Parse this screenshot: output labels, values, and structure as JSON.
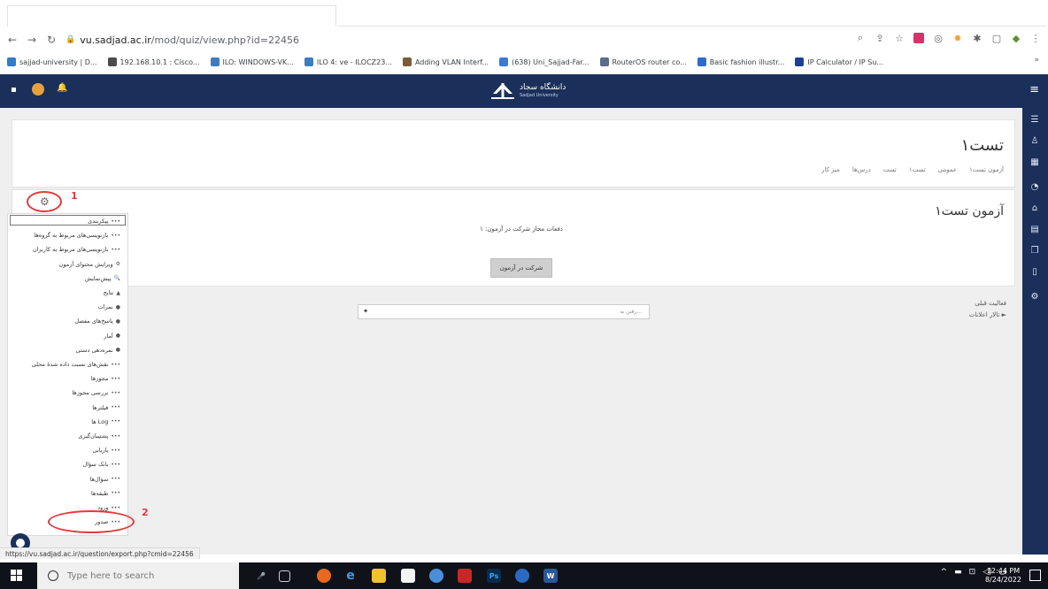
{
  "browser": {
    "url_host": "vu.sadjad.ac.ir",
    "url_path": "/mod/quiz/view.php?id=22456",
    "bookmarks": [
      {
        "label": "sajjad-university | D...",
        "color": "#2f7dc7"
      },
      {
        "label": "192.168.10.1 : Cisco...",
        "color": "#4b4b4b"
      },
      {
        "label": "ILO: WINDOWS-VK...",
        "color": "#3c7dbf"
      },
      {
        "label": "ILO 4: ve - ILOCZ23...",
        "color": "#3c7dbf"
      },
      {
        "label": "Adding VLAN Interf...",
        "color": "#7a5c3a"
      },
      {
        "label": "(638) Uni_Sajjad-Far...",
        "color": "#3a7bd5"
      },
      {
        "label": "RouterOS router co...",
        "color": "#5b6b8a"
      },
      {
        "label": "Basic fashion illustr...",
        "color": "#2a6ec9"
      },
      {
        "label": "IP Calculator / IP Su...",
        "color": "#1c3f95"
      }
    ],
    "bookmarks_more": "»",
    "status_url": "https://vu.sadjad.ac.ir/question/export.php?cmid=22456"
  },
  "header": {
    "logo_title": "دانشگاه سجاد",
    "logo_subtitle": "Sadjad University"
  },
  "course": {
    "title": "تست۱",
    "breadcrumbs": [
      "میز کار",
      "درس‌ها",
      "تست",
      "تست۱",
      "عمومی",
      "آزمون تست۱"
    ]
  },
  "quiz": {
    "title": "آزمون تست۱",
    "attempts_text": "دفعات مجاز شرکت در آزمون: ۱",
    "attempt_button": "شرکت در آزمون"
  },
  "activity": {
    "prev_label": "فعالیت قبلی",
    "forum_label": "► تالار اعلانات",
    "jump_placeholder": "رفتن به...",
    "jump_caret": "⬥"
  },
  "settings_menu": {
    "items": [
      {
        "label": "پیکربندی",
        "bullet": "•••"
      },
      {
        "label": "بازنویسی‌های مربوط به گروه‌ها",
        "bullet": "•••"
      },
      {
        "label": "بازنویسی‌های مربوط به کاربران",
        "bullet": "•••"
      },
      {
        "label": "ویرایش محتوای آزمون",
        "bullet": "⚙"
      },
      {
        "label": "پیش‌نمایش",
        "bullet": "🔍"
      },
      {
        "label": "نتایج",
        "bullet": "▲"
      },
      {
        "label": "نمرات",
        "bullet": "●"
      },
      {
        "label": "پاسخ‌های مفصل",
        "bullet": "●"
      },
      {
        "label": "آمار",
        "bullet": "●"
      },
      {
        "label": "نمره‌دهی دستی",
        "bullet": "●"
      },
      {
        "label": "نقش‌های نسبت داده شدهٔ محلی",
        "bullet": "•••"
      },
      {
        "label": "مجوزها",
        "bullet": "•••"
      },
      {
        "label": "بررسی مجوزها",
        "bullet": "•••"
      },
      {
        "label": "فیلترها",
        "bullet": "•••"
      },
      {
        "label": "Log ها",
        "bullet": "•••"
      },
      {
        "label": "پشتیبان‌گیری",
        "bullet": "•••"
      },
      {
        "label": "بازیابی",
        "bullet": "•••"
      },
      {
        "label": "بانک سؤال",
        "bullet": "•••"
      },
      {
        "label": "سؤال‌ها",
        "bullet": "•••"
      },
      {
        "label": "طبقه‌ها",
        "bullet": "•••"
      },
      {
        "label": "ورود",
        "bullet": "•••"
      },
      {
        "label": "صدور",
        "bullet": "•••"
      }
    ],
    "callout_1": "1",
    "callout_2": "2"
  },
  "taskbar": {
    "search_placeholder": "Type here to search",
    "time": "12:44 PM",
    "date": "8/24/2022"
  }
}
